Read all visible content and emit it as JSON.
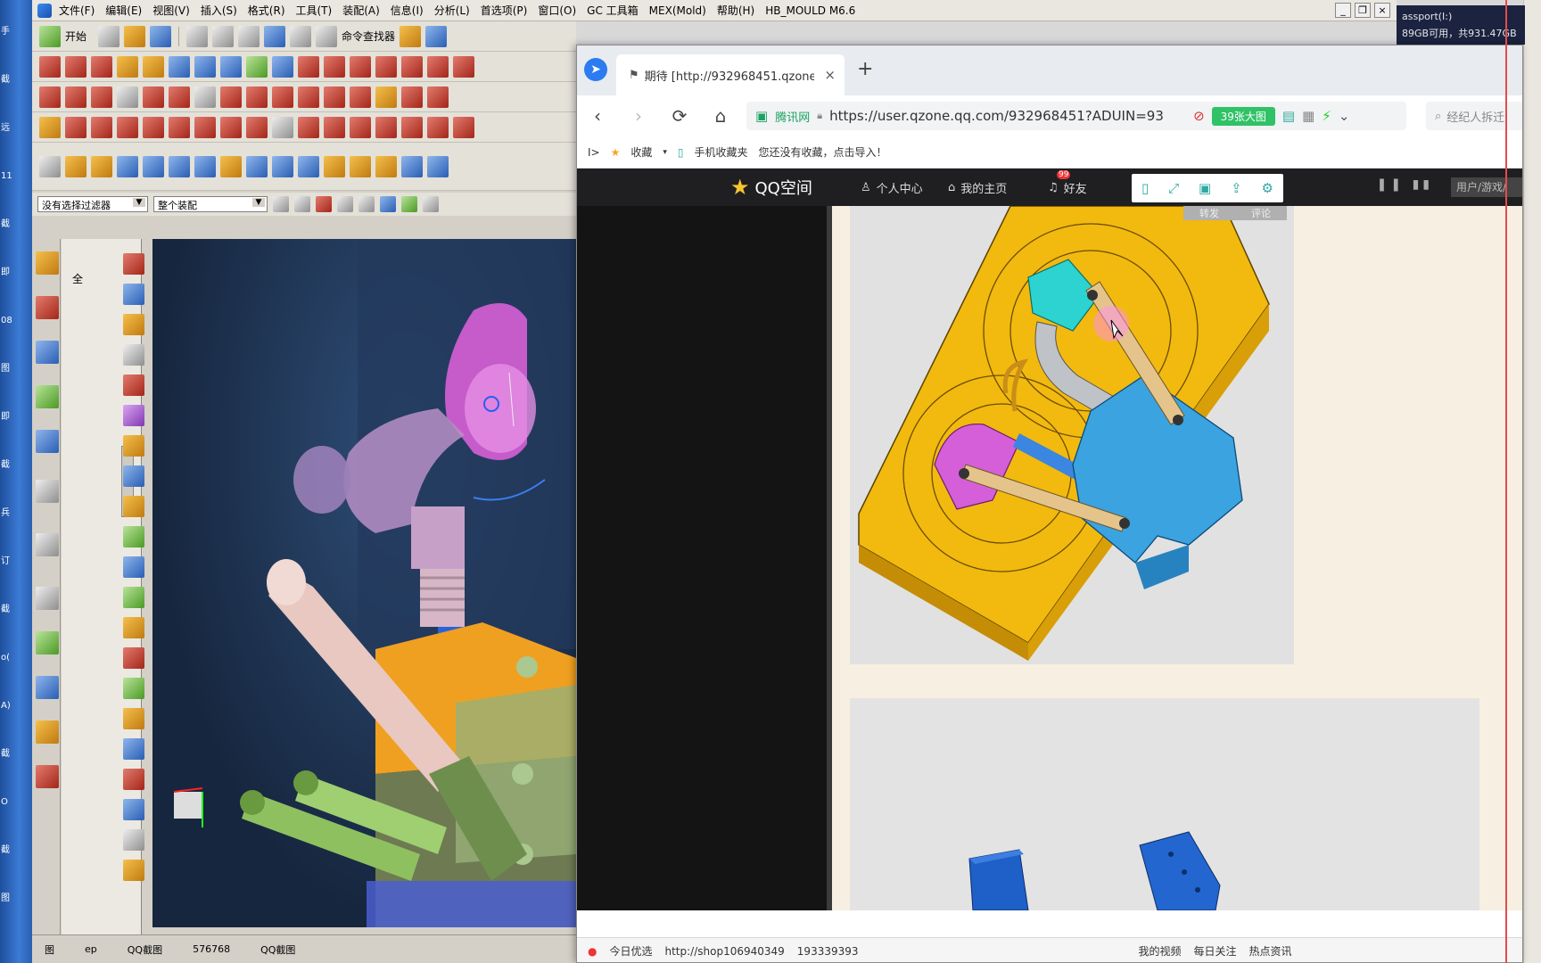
{
  "desktop": {
    "strip_labels": [
      "手",
      "截",
      "远",
      "11",
      "截",
      "即",
      "08",
      "图",
      "即",
      "截",
      "兵",
      "订",
      "截",
      "o(",
      "A)",
      "截",
      "O",
      "截",
      "图"
    ]
  },
  "cad": {
    "menu": [
      "文件(F)",
      "编辑(E)",
      "视图(V)",
      "插入(S)",
      "格式(R)",
      "工具(T)",
      "装配(A)",
      "信息(I)",
      "分析(L)",
      "首选项(P)",
      "窗口(O)",
      "GC 工具箱",
      "MEX(Mold)",
      "帮助(H)",
      "HB_MOULD M6.6"
    ],
    "toolbar": {
      "start_label": "开始",
      "command_finder": "命令查找器"
    },
    "filters": {
      "selection_filter": "没有选择过滤器",
      "assembly_scope": "整个装配"
    },
    "nav_panel_tab": "全",
    "status": [
      "图",
      "ep",
      "QQ截图",
      "576768",
      "QQ截图"
    ]
  },
  "browser": {
    "tab": {
      "title": "期待 [http://932968451.qzone",
      "close": "×",
      "new_tab": "+"
    },
    "nav": {
      "back": "‹",
      "forward": "›",
      "reload": "⟳",
      "home": "⌂"
    },
    "url": {
      "secure_label": "腾讯网",
      "text": "https://user.qzone.qq.com/932968451?ADUIN=93",
      "pill": "39张大图"
    },
    "search_placeholder": "经纪人拆迁",
    "bookmarks": {
      "collapse": "I>",
      "favorites": "收藏",
      "mobile": "手机收藏夹",
      "hint": "您还没有收藏，点击导入！"
    },
    "qzone": {
      "logo": "QQ空间",
      "nav": [
        "个人中心",
        "我的主页",
        "好友"
      ],
      "friend_badge": "99",
      "user_box": "用户/游戏/",
      "share": [
        "转发",
        "评论"
      ]
    },
    "status": [
      "今日优选",
      "http://shop106940349",
      "193339393",
      "我的视频",
      "每日关注",
      "热点资讯"
    ]
  },
  "system": {
    "line1": "assport(I:)",
    "line2": "89GB可用，共931.47GB"
  },
  "colors": {
    "mold_yellow": "#f2b90f",
    "part_blue": "#3aa3e0",
    "part_cyan": "#2cd3d0",
    "part_magenta": "#d55fd8",
    "arm_tan": "#e5c48c"
  }
}
